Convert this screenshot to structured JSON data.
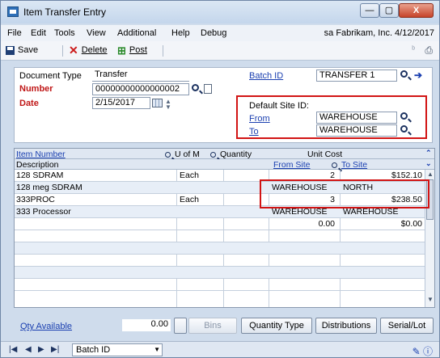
{
  "window": {
    "title": "Item Transfer Entry",
    "min_label": "—",
    "max_label": "▢",
    "close_label": "X"
  },
  "menu": {
    "items": [
      "File",
      "Edit",
      "Tools",
      "View",
      "Additional",
      "Help",
      "Debug"
    ],
    "company_info": "sa  Fabrikam, Inc.  4/12/2017"
  },
  "toolbar": {
    "save_label": "Save",
    "delete_label": "Delete",
    "post_label": "Post"
  },
  "header": {
    "document_type_label": "Document Type",
    "document_type_value": "Transfer",
    "number_label": "Number",
    "number_value": "00000000000000002",
    "date_label": "Date",
    "date_value": "2/15/2017",
    "batch_id_label": "Batch ID",
    "batch_id_value": "TRANSFER 1",
    "default_site_label": "Default Site ID:",
    "from_label": "From",
    "from_value": "WAREHOUSE",
    "to_label": "To",
    "to_value": "WAREHOUSE"
  },
  "grid": {
    "header_row1": {
      "item_number": "Item Number",
      "u_of_m": "U of M",
      "quantity": "Quantity",
      "unit_cost": "Unit Cost"
    },
    "header_row2": {
      "description": "Description",
      "from_site": "From Site",
      "to_site": "To Site"
    },
    "rows": [
      {
        "c1": "128 SDRAM",
        "c2": "Each",
        "c3": "2",
        "c4": "",
        "c5": "$152.10"
      },
      {
        "c1": "128 meg SDRAM",
        "c2": "",
        "c3": "",
        "c4": "WAREHOUSE",
        "c5": "NORTH"
      },
      {
        "c1": "333PROC",
        "c2": "Each",
        "c3": "3",
        "c4": "",
        "c5": "$238.50"
      },
      {
        "c1": "333 Processor",
        "c2": "",
        "c3": "",
        "c4": "WAREHOUSE",
        "c5": "WAREHOUSE"
      },
      {
        "c1": "",
        "c2": "",
        "c3": "0.00",
        "c4": "",
        "c5": "$0.00"
      },
      {
        "c1": "",
        "c2": "",
        "c3": "",
        "c4": "",
        "c5": ""
      },
      {
        "c1": "",
        "c2": "",
        "c3": "",
        "c4": "",
        "c5": ""
      },
      {
        "c1": "",
        "c2": "",
        "c3": "",
        "c4": "",
        "c5": ""
      },
      {
        "c1": "",
        "c2": "",
        "c3": "",
        "c4": "",
        "c5": ""
      },
      {
        "c1": "",
        "c2": "",
        "c3": "",
        "c4": "",
        "c5": ""
      }
    ]
  },
  "bottom": {
    "qty_available_label": "Qty Available",
    "qty_available_value": "0.00",
    "bins_label": "Bins",
    "quantity_type_label": "Quantity Type",
    "distributions_label": "Distributions",
    "serial_lot_label": "Serial/Lot"
  },
  "status": {
    "browse_field": "Batch ID"
  },
  "colors": {
    "highlight": "#d21414",
    "link": "#1a3fb0",
    "required": "#c01818"
  }
}
